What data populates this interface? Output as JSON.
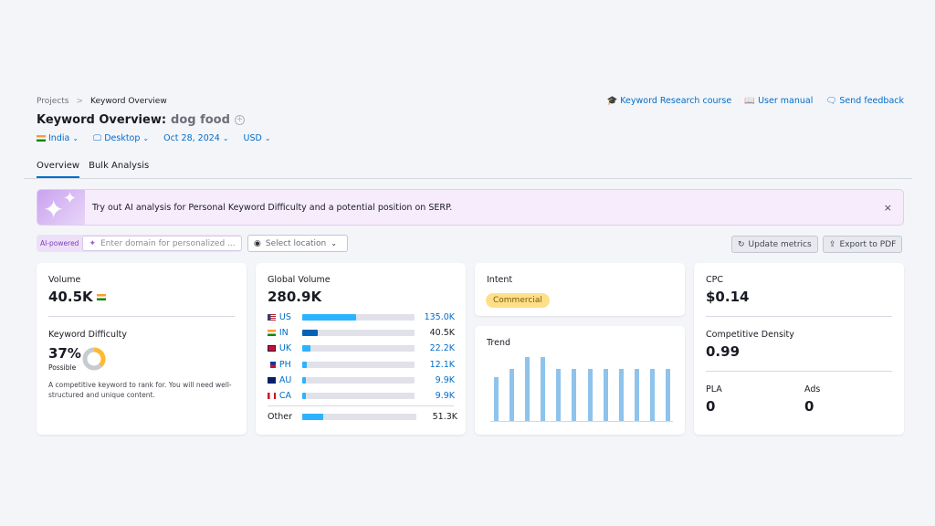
{
  "breadcrumb": {
    "items": [
      "Projects",
      "Keyword Overview"
    ],
    "separator": ">"
  },
  "header": {
    "title": "Keyword Overview:",
    "keyword": "dog food"
  },
  "filters": {
    "country": "India",
    "device": "Desktop",
    "date": "Oct 28, 2024",
    "currency": "USD"
  },
  "links": {
    "course": "Keyword Research course",
    "manual": "User manual",
    "feedback": "Send feedback"
  },
  "tabs": [
    {
      "label": "Overview",
      "active": true
    },
    {
      "label": "Bulk Analysis",
      "active": false
    }
  ],
  "banner": {
    "text": "Try out AI analysis for Personal Keyword Difficulty and a potential position on SERP.",
    "close": "×"
  },
  "ai": {
    "tag": "AI-powered",
    "placeholder": "Enter domain for personalized ...",
    "location_placeholder": "Select location"
  },
  "buttons": {
    "update": "Update metrics",
    "export": "Export to PDF"
  },
  "volume": {
    "label": "Volume",
    "value": "40.5K"
  },
  "kd": {
    "label": "Keyword Difficulty",
    "value": "37%",
    "percent": 37,
    "level": "Possible",
    "description": "A competitive keyword to rank for. You will need well-structured and unique content."
  },
  "global": {
    "label": "Global Volume",
    "value": "280.9K",
    "rows": [
      {
        "code": "US",
        "value": "135.0K",
        "share": 0.48,
        "highlight": false
      },
      {
        "code": "IN",
        "value": "40.5K",
        "share": 0.144,
        "highlight": true
      },
      {
        "code": "UK",
        "value": "22.2K",
        "share": 0.079,
        "highlight": false
      },
      {
        "code": "PH",
        "value": "12.1K",
        "share": 0.043,
        "highlight": false
      },
      {
        "code": "AU",
        "value": "9.9K",
        "share": 0.035,
        "highlight": false
      },
      {
        "code": "CA",
        "value": "9.9K",
        "share": 0.035,
        "highlight": false
      }
    ],
    "other": {
      "label": "Other",
      "value": "51.3K",
      "share": 0.183
    }
  },
  "intent": {
    "label": "Intent",
    "value": "Commercial"
  },
  "trend": {
    "label": "Trend",
    "values": [
      0.68,
      0.82,
      1,
      1,
      0.82,
      0.82,
      0.82,
      0.82,
      0.82,
      0.82,
      0.82,
      0.82
    ]
  },
  "cpc": {
    "label": "CPC",
    "value": "$0.14"
  },
  "density": {
    "label": "Competitive Density",
    "value": "0.99"
  },
  "pla": {
    "label": "PLA",
    "value": "0"
  },
  "ads": {
    "label": "Ads",
    "value": "0"
  },
  "colors": {
    "accent": "#006dca",
    "bar": "#2bb3ff",
    "bar_highlight": "#0063b8",
    "trend": "#8ec3ec",
    "intent": "#ffe08a",
    "kd_fill": "#fdba35"
  }
}
